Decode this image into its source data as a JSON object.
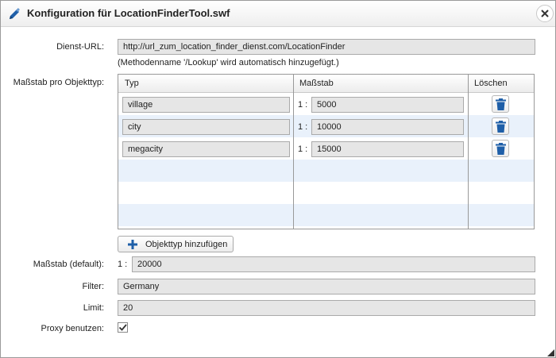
{
  "dialog": {
    "title": "Konfiguration für LocationFinderTool.swf"
  },
  "service": {
    "label": "Dienst-URL:",
    "value": "http://url_zum_location_finder_dienst.com/LocationFinder",
    "hint": "(Methodenname '/Lookup' wird automatisch hinzugefügt.)"
  },
  "scale_table": {
    "label": "Maßstab pro Objekttyp:",
    "columns": {
      "type": "Typ",
      "scale": "Maßstab",
      "delete": "Löschen"
    },
    "scale_prefix": "1 :",
    "rows": [
      {
        "type": "village",
        "scale": "5000"
      },
      {
        "type": "city",
        "scale": "10000"
      },
      {
        "type": "megacity",
        "scale": "15000"
      }
    ],
    "add_button": "Objekttyp hinzufügen"
  },
  "default_scale": {
    "label": "Maßstab (default):",
    "prefix": "1 :",
    "value": "20000"
  },
  "filter": {
    "label": "Filter:",
    "value": "Germany"
  },
  "limit": {
    "label": "Limit:",
    "value": "20"
  },
  "proxy": {
    "label": "Proxy benutzen:",
    "checked": true
  },
  "icons": {
    "title": "pencil-icon",
    "close": "close-icon",
    "delete": "trash-icon",
    "add": "plus-icon",
    "check": "check-icon",
    "resize": "resize-grip-icon"
  },
  "colors": {
    "accent": "#1f5fa8",
    "field_bg": "#e6e6e6",
    "alt_row": "#e9f1fb"
  }
}
